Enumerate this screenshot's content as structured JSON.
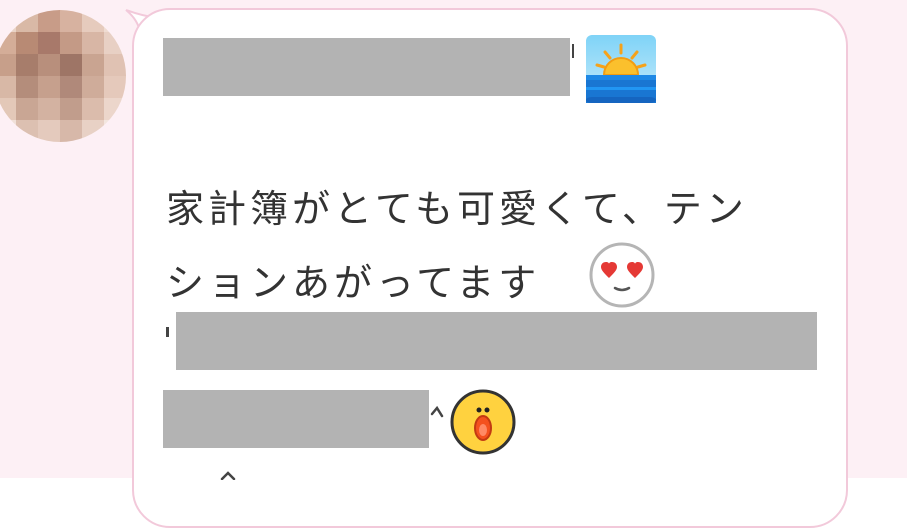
{
  "message": {
    "line1": "家計簿がとても可愛くて、テン",
    "line2": "ションあがってます"
  },
  "icons": {
    "sunrise": "sunrise-emoji-icon",
    "heart_eyes": "heart-eyes-emoji-icon",
    "sally": "sally-surprised-emoji-icon"
  },
  "colors": {
    "chat_background": "#fdf0f5",
    "bubble_border": "#f2c9da",
    "redaction": "#b3b3b3",
    "text": "#333333"
  }
}
